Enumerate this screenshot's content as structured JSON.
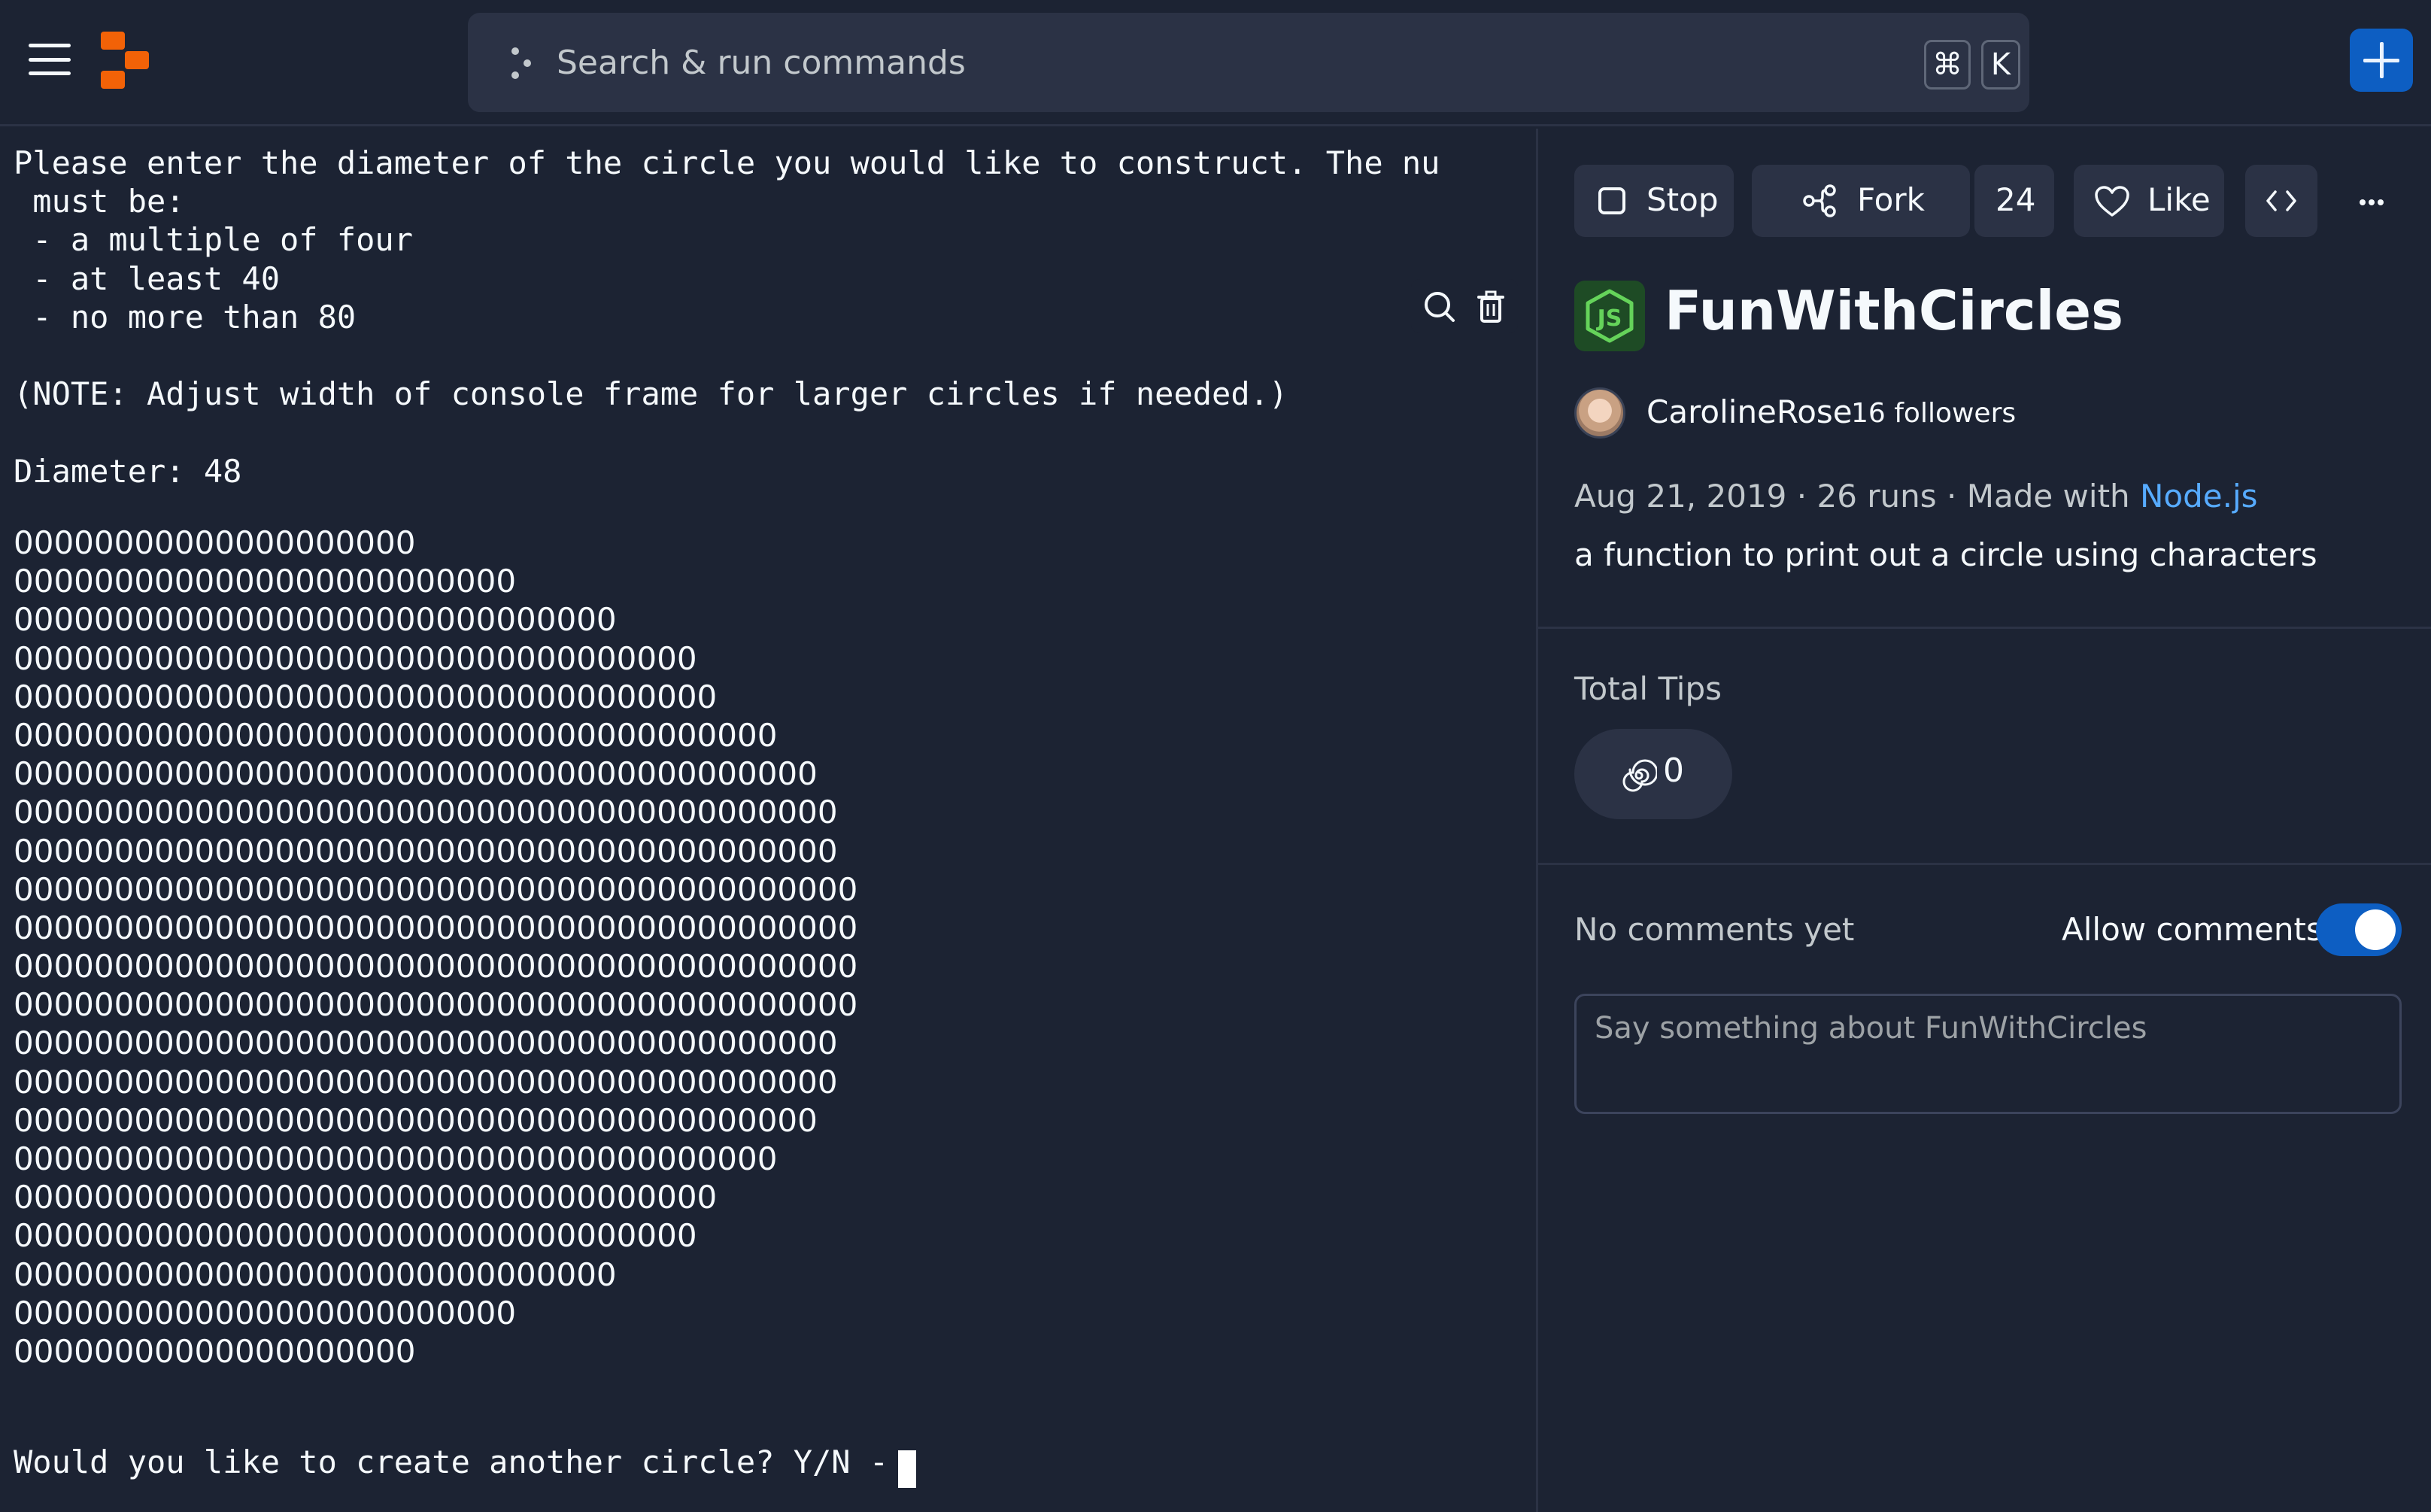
{
  "colors": {
    "accent": "#0d5ec2",
    "brand": "#f26207",
    "link": "#57abff",
    "background": "#1c2333",
    "surface": "#2b3245"
  },
  "topbar": {
    "search_placeholder": "Search & run commands",
    "shortcut_cmd": "⌘",
    "shortcut_key": "K",
    "icons": [
      "menu-icon",
      "replit-logo",
      "command-dots-icon",
      "plus-icon"
    ]
  },
  "console": {
    "intro_line": "Please enter the diameter of the circle you would like to construct. The nu",
    "intro_rest": " must be:\n - a multiple of four\n - at least 40\n - no more than 80\n\n(NOTE: Adjust width of console frame for larger circles if needed.)\n\nDiameter: 48",
    "circle_rows": [
      "00000000000000000000",
      "0000000000000000000000000",
      "000000000000000000000000000000",
      "0000000000000000000000000000000000",
      "00000000000000000000000000000000000",
      "00000000000000000000000000000000000000",
      "0000000000000000000000000000000000000000",
      "00000000000000000000000000000000000000000",
      "00000000000000000000000000000000000000000",
      "000000000000000000000000000000000000000000",
      "000000000000000000000000000000000000000000",
      "000000000000000000000000000000000000000000",
      "000000000000000000000000000000000000000000",
      "00000000000000000000000000000000000000000",
      "00000000000000000000000000000000000000000",
      "0000000000000000000000000000000000000000",
      "00000000000000000000000000000000000000",
      "00000000000000000000000000000000000",
      "0000000000000000000000000000000000",
      "000000000000000000000000000000",
      "0000000000000000000000000",
      "00000000000000000000"
    ],
    "prompt": "Would you like to create another circle? Y/N - ",
    "tools": [
      "search-icon",
      "trash-icon"
    ]
  },
  "actions": {
    "stop_label": "Stop",
    "fork_label": "Fork",
    "fork_count": "24",
    "like_label": "Like",
    "embed_icon": "code-icon",
    "more_icon": "more-icon"
  },
  "repl": {
    "language_icon": "nodejs-icon",
    "title": "FunWithCircles",
    "author": "CarolineRose",
    "followers": "16 followers",
    "date": "Aug 21, 2019",
    "sep1": " · ",
    "runs": "26 runs",
    "sep2": " · ",
    "made_with": "Made with ",
    "language": "Node.js",
    "description": "a function to print out a circle using characters"
  },
  "tips": {
    "label": "Total Tips",
    "count": "0",
    "icon": "cycles-icon"
  },
  "comments": {
    "empty_text": "No comments yet",
    "allow_label": "Allow comments",
    "allow_enabled": true,
    "placeholder": "Say something about FunWithCircles"
  }
}
